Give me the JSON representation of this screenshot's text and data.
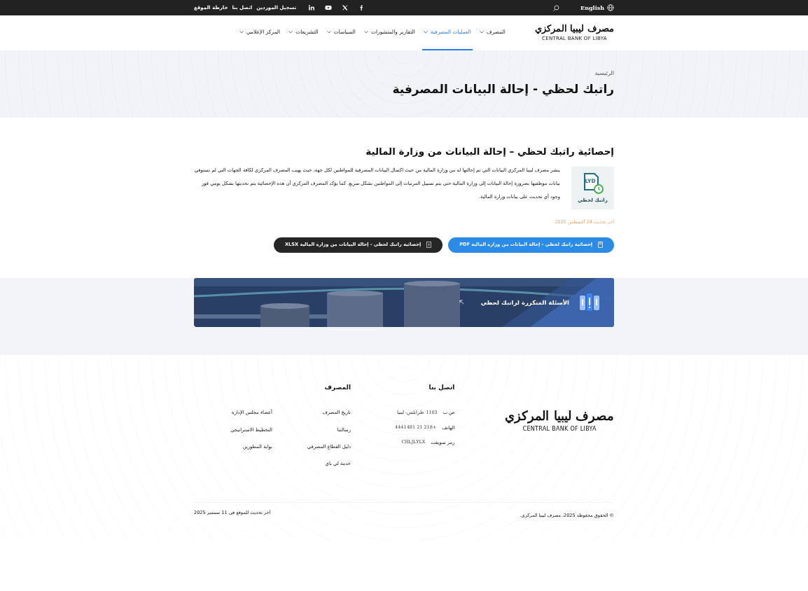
{
  "topbar": {
    "language": "English",
    "social": [
      {
        "kind": "facebook"
      },
      {
        "kind": "x"
      },
      {
        "kind": "youtube"
      },
      {
        "kind": "linkedin"
      }
    ],
    "links": [
      "تسجيل الموردين",
      "اتصل بنا",
      "خارطة الموقع"
    ]
  },
  "header": {
    "logo": {
      "name": "مصرف ليبيا المركزي",
      "subtitle": "CENTRAL BANK OF LIBYA"
    },
    "nav": [
      {
        "label": "المصرف",
        "selected": false
      },
      {
        "label": "العمليات المصرفية",
        "selected": true
      },
      {
        "label": "التقارير والمنشورات",
        "selected": false
      },
      {
        "label": "السياسات",
        "selected": false
      },
      {
        "label": "التشريعات",
        "selected": false
      },
      {
        "label": "المركز الإعلامي",
        "selected": false
      }
    ]
  },
  "page_header": {
    "breadcrumb": "الرئيسية",
    "title": "راتبك لحظي - إحالة البيانات المصرفية"
  },
  "article": {
    "title": "إحصائية راتبك لحظي – إحالة البيانات من وزارة المالية",
    "image": {
      "badge": "LYD",
      "caption": "راتبك لحظي"
    },
    "body": "ينشر مصرف ليبيا المركزي البيانات التي تم إحالتها له من وزارة المالية من حيث اكتمال البيانات المصرفية للمواطنين لكل جهة، حيث يهيب المصرف المركزي لكافة الجهات التي لم تستوفي بيانات موظفيها بضرورة إحالة البيانات إلى وزارة المالية حتى يتم تسييل المرتبات إلى المواطنين بشكل سريع. كما يؤكد المصرف المركزي أن هذه الإحصائية يتم تحديثها بشكل يومي فور وجود أي تحديث على بيانات وزارة المالية.",
    "updated": "آخر تحديث 24 أغسطس 2025",
    "downloads": [
      {
        "kind": "pdf",
        "label": "إحصائية راتبك لحظي - إحالة البيانات من وزارة المالية PDF"
      },
      {
        "kind": "xlsx",
        "label": "إحصائية راتبك لحظي - إحالة البيانات من وزارة المالية XLSX"
      }
    ]
  },
  "faq_banner": {
    "label": "الأسئلة المتكررة لراتبك لحظي"
  },
  "footer": {
    "logo": {
      "name": "مصرف ليبيا المركزي",
      "subtitle": "CENTRAL BANK OF LIBYA"
    },
    "contact": {
      "heading": "اتصل بنا",
      "rows": [
        {
          "label": "ص.ب",
          "value": "1103 طرابلس- ليبيا"
        },
        {
          "label": "الهاتف",
          "value": "+218 21 4441481"
        },
        {
          "label": "رمز سويفت",
          "value": "CBLJLYLX"
        }
      ]
    },
    "bank": {
      "heading": "المصرف",
      "columns": [
        [
          "تاريخ المصرف",
          "رسالتنا",
          "دليل القطاع المصرفي",
          "خدمة لي باي"
        ],
        [
          "أعضاء مجلس الإدارة",
          "التخطيط الاستراتيجي",
          "بوابة المطورين"
        ]
      ]
    },
    "copyright": "© الحقوق محفوظة 2025، مصرف ليبيا المركزي.",
    "site_updated": "آخر تحديث للموقع في 11 سبتمبر 2025"
  }
}
